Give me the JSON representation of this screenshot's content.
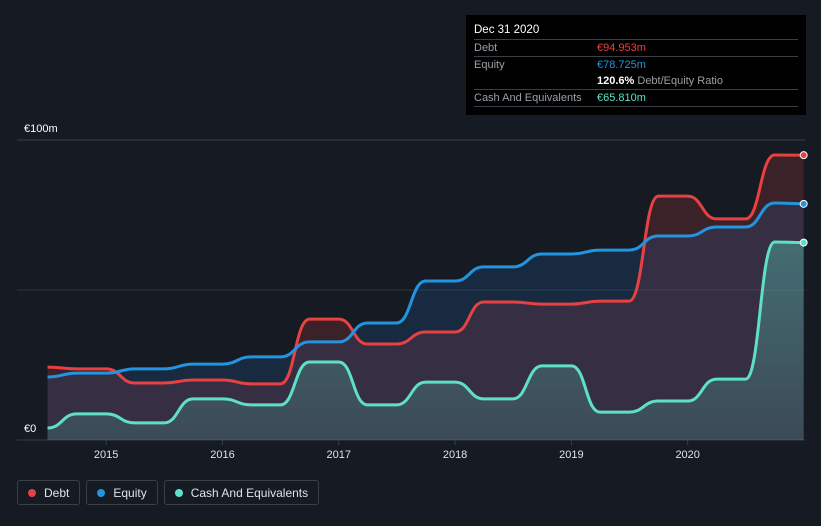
{
  "chart_data": {
    "type": "area",
    "x": [
      "2014-07-01",
      "2014-10-01",
      "2015-01-01",
      "2015-04-01",
      "2015-07-01",
      "2015-10-01",
      "2016-01-01",
      "2016-04-01",
      "2016-07-01",
      "2016-10-01",
      "2017-01-01",
      "2017-04-01",
      "2017-07-01",
      "2017-10-01",
      "2018-01-01",
      "2018-04-01",
      "2018-07-01",
      "2018-10-01",
      "2019-01-01",
      "2019-04-01",
      "2019-07-01",
      "2019-10-01",
      "2020-01-01",
      "2020-04-01",
      "2020-07-01",
      "2020-10-01",
      "2020-12-31"
    ],
    "series": [
      {
        "name": "Debt",
        "color": "#e84142",
        "values": [
          24.3,
          23.7,
          23.7,
          19,
          19,
          20,
          20,
          18.7,
          18.7,
          40.3,
          40.3,
          32,
          32,
          36,
          36,
          46,
          46,
          45.3,
          45.3,
          46.3,
          46.3,
          81.3,
          81.3,
          73.7,
          73.7,
          95,
          94.953
        ]
      },
      {
        "name": "Equity",
        "color": "#2394df",
        "values": [
          21,
          22.3,
          22.3,
          23.7,
          23.7,
          25.3,
          25.3,
          27.7,
          27.7,
          32.7,
          32.7,
          39,
          39,
          53,
          53,
          57.7,
          57.7,
          62,
          62,
          63.3,
          63.3,
          68,
          68,
          71,
          71,
          79,
          78.725
        ]
      },
      {
        "name": "Cash And Equivalents",
        "color": "#5ee0c8",
        "values": [
          4,
          8.7,
          8.7,
          5.7,
          5.7,
          13.7,
          13.7,
          11.7,
          11.7,
          26,
          26,
          11.7,
          11.7,
          19.3,
          19.3,
          13.7,
          13.7,
          24.7,
          24.7,
          9.3,
          9.3,
          13,
          13,
          20.3,
          20.3,
          66,
          65.81
        ]
      }
    ],
    "ylim": [
      0,
      100
    ],
    "y_tick_labels": [
      "€0",
      "€100m"
    ],
    "x_tick_labels": [
      "2015",
      "2016",
      "2017",
      "2018",
      "2019",
      "2020"
    ],
    "grid": true,
    "legend_placement": "bottom-left"
  },
  "tooltip": {
    "date": "Dec 31 2020",
    "debt_label": "Debt",
    "debt_value": "€94.953m",
    "equity_label": "Equity",
    "equity_value": "€78.725m",
    "ratio_value": "120.6%",
    "ratio_label": "Debt/Equity Ratio",
    "cash_label": "Cash And Equivalents",
    "cash_value": "€65.810m"
  },
  "legend": [
    {
      "label": "Debt",
      "color": "#e84142"
    },
    {
      "label": "Equity",
      "color": "#2394df"
    },
    {
      "label": "Cash And Equivalents",
      "color": "#5ee0c8"
    }
  ]
}
